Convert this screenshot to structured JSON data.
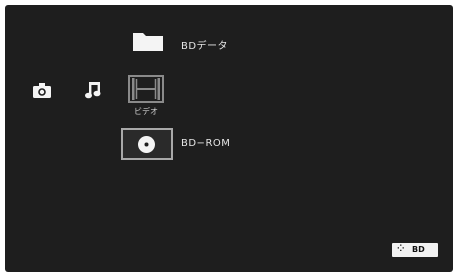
{
  "menu": {
    "folder_label": "BDデータ",
    "video_label": "ビデオ",
    "disc_label": "BD−ROM"
  },
  "badge": {
    "text": "BD"
  },
  "icons": [
    "folder-icon",
    "camera-icon",
    "music-note-icon",
    "film-icon",
    "disc-icon",
    "bd-logo-icon"
  ],
  "colors": {
    "background": "#1e1e1e",
    "text": "#e6e6e6",
    "selection": "#a9a9a9"
  }
}
